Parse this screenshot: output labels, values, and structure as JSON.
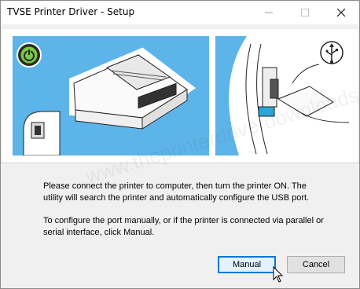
{
  "window": {
    "title": "TVSE Printer Driver - Setup"
  },
  "titlebar_buttons": {
    "minimize_icon": "minimize-icon",
    "maximize_icon": "maximize-icon",
    "close_icon": "close-icon"
  },
  "banner": {
    "power_icon": "power-icon",
    "usb_icon": "usb-icon",
    "illustration": "printer-illustration",
    "watermark": "www.theprinterdriverdownloads.org"
  },
  "message": {
    "line1": "Please connect the printer to computer, then turn the printer ON. The utility will search the printer and automatically configure the USB port.",
    "line2": "To configure the port manually, or if the printer is connected via parallel or serial interface, click Manual."
  },
  "buttons": {
    "manual": "Manual",
    "cancel": "Cancel"
  },
  "colors": {
    "banner_blue": "#5db4e8",
    "power_green": "#7ac943",
    "focus_blue": "#0078d7"
  }
}
